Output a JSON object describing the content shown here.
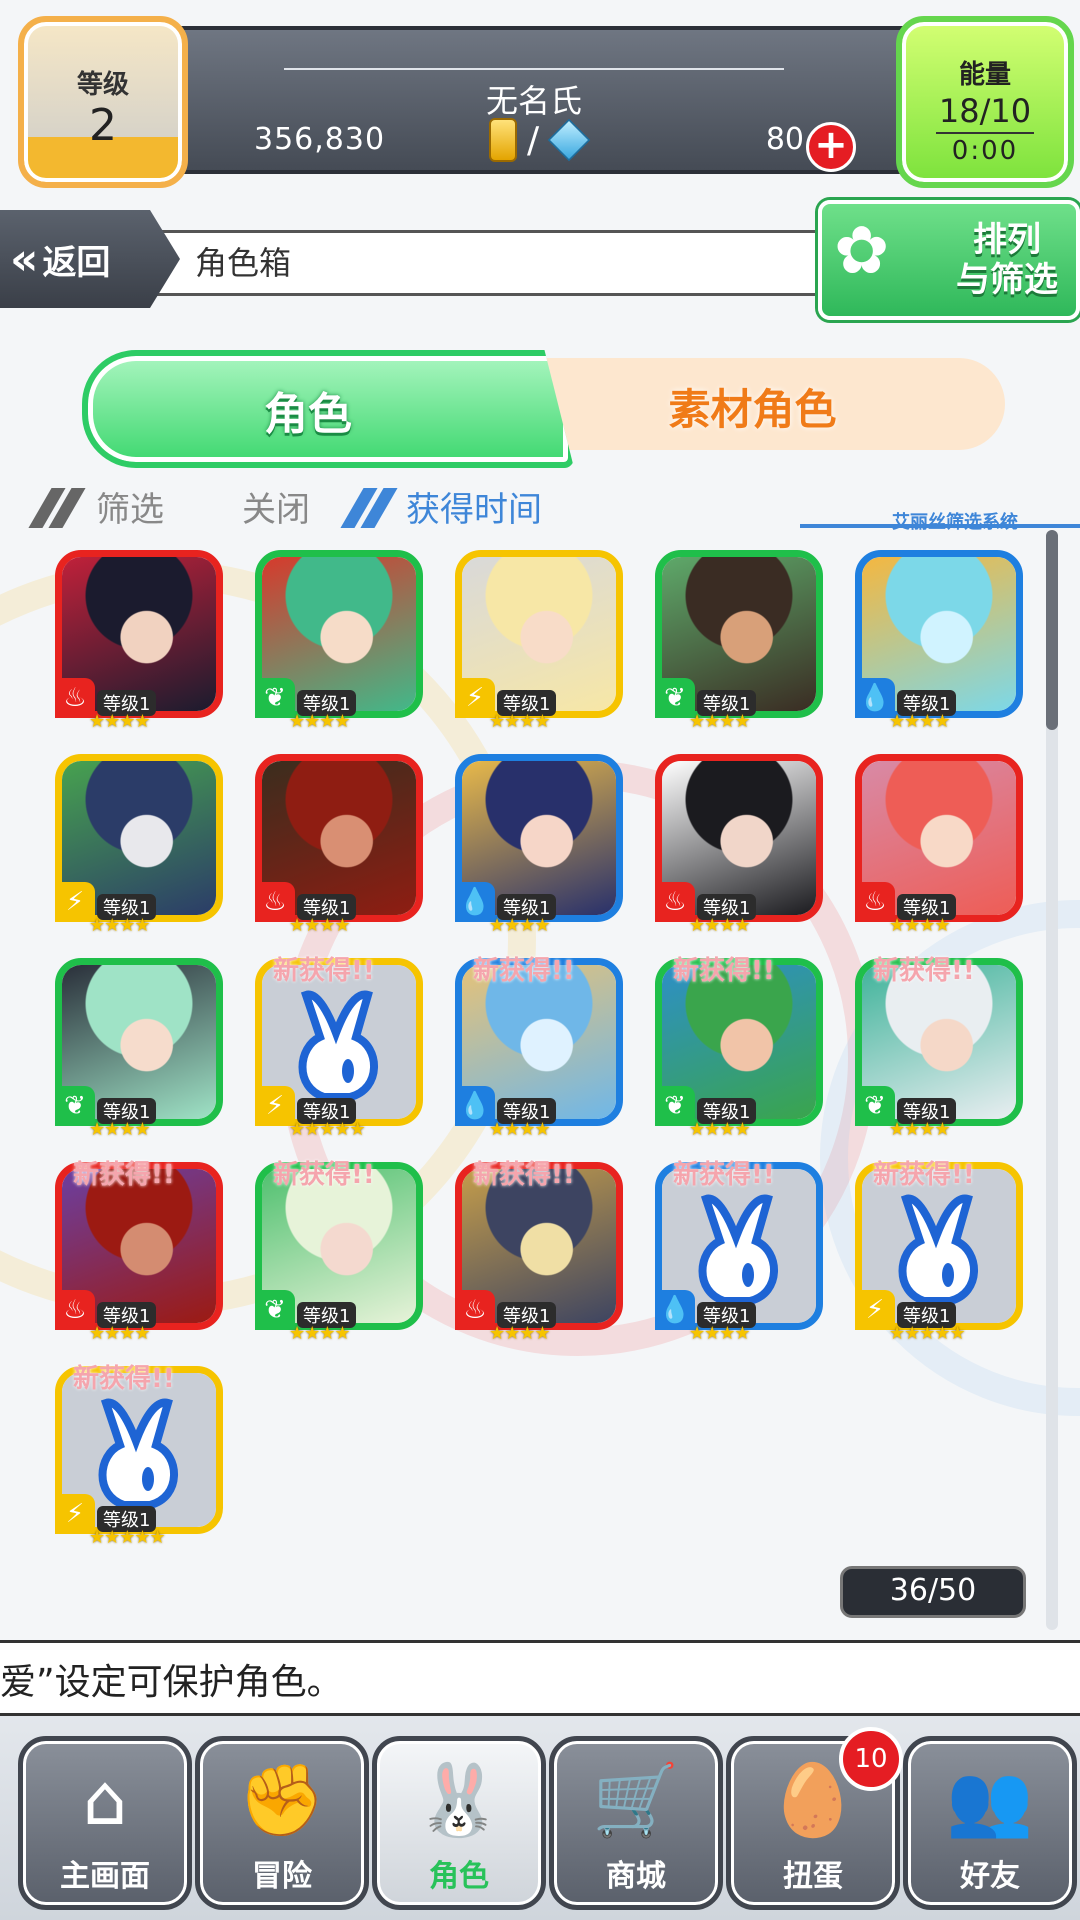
{
  "player": {
    "level_label": "等级",
    "level": "2",
    "name": "无名氏",
    "gold": "356,830",
    "currency_separator": "/",
    "gems": "80",
    "add_symbol": "+"
  },
  "energy": {
    "label": "能量",
    "value": "18/10",
    "timer": "0:00"
  },
  "header": {
    "back_label": "返回",
    "back_icon": "«",
    "title": "角色箱",
    "sort_label_line1": "排列",
    "sort_label_line2": "与筛选"
  },
  "tabs": {
    "characters": "角色",
    "materials": "素材角色"
  },
  "filter": {
    "filter_label": "筛选",
    "filter_state": "关闭",
    "sort_label": "获得时间",
    "system_label": "艾丽丝筛选系统"
  },
  "elements": {
    "fire": {
      "color": "#e8231f",
      "glyph": "♨"
    },
    "wood": {
      "color": "#1fbf4a",
      "glyph": "❦"
    },
    "thunder": {
      "color": "#f6c400",
      "glyph": "⚡"
    },
    "water": {
      "color": "#1e7fe0",
      "glyph": "💧"
    }
  },
  "cards": [
    {
      "element": "fire",
      "level": "等级1",
      "stars": "★★★★",
      "new": "",
      "rabbit": false,
      "art": [
        "#1b1b2e",
        "#f1d2c0",
        "#c0213a"
      ]
    },
    {
      "element": "wood",
      "level": "等级1",
      "stars": "★★★★",
      "new": "",
      "rabbit": false,
      "art": [
        "#41b98a",
        "#f6dcc8",
        "#d63a2c"
      ]
    },
    {
      "element": "thunder",
      "level": "等级1",
      "stars": "★★★★",
      "new": "",
      "rabbit": false,
      "art": [
        "#f7e7a6",
        "#f8dcc8",
        "#d9d9d9"
      ]
    },
    {
      "element": "wood",
      "level": "等级1",
      "stars": "★★★★",
      "new": "",
      "rabbit": false,
      "art": [
        "#3a2c23",
        "#d8a079",
        "#5ea96a"
      ]
    },
    {
      "element": "water",
      "level": "等级1",
      "stars": "★★★★",
      "new": "",
      "rabbit": false,
      "art": [
        "#7cd8e8",
        "#d0f3ff",
        "#f4b740"
      ]
    },
    {
      "element": "thunder",
      "level": "等级1",
      "stars": "★★★★",
      "new": "",
      "rabbit": false,
      "art": [
        "#2b3c68",
        "#e8e8ec",
        "#47a24f"
      ]
    },
    {
      "element": "fire",
      "level": "等级1",
      "stars": "★★★★",
      "new": "",
      "rabbit": false,
      "art": [
        "#8f1d12",
        "#d98f73",
        "#3b2d1e"
      ]
    },
    {
      "element": "water",
      "level": "等级1",
      "stars": "★★★★",
      "new": "",
      "rabbit": false,
      "art": [
        "#28306b",
        "#f6d6c8",
        "#e8b94a"
      ]
    },
    {
      "element": "fire",
      "level": "等级1",
      "stars": "★★★★",
      "new": "",
      "rabbit": false,
      "art": [
        "#1b1b1f",
        "#f1d6c9",
        "#ffffff"
      ]
    },
    {
      "element": "fire",
      "level": "等级1",
      "stars": "★★★★",
      "new": "",
      "rabbit": false,
      "art": [
        "#ee5d56",
        "#f8d9c7",
        "#d88aa6"
      ]
    },
    {
      "element": "wood",
      "level": "等级1",
      "stars": "★★★★",
      "new": "",
      "rabbit": false,
      "art": [
        "#9fe3c6",
        "#f6dccc",
        "#2a2f3a"
      ]
    },
    {
      "element": "thunder",
      "level": "等级1",
      "stars": "★★★★★",
      "new": "新获得!!",
      "rabbit": true,
      "art": []
    },
    {
      "element": "water",
      "level": "等级1",
      "stars": "★★★★",
      "new": "新获得!!",
      "rabbit": false,
      "art": [
        "#6fb7e8",
        "#dff2ff",
        "#e6c278"
      ]
    },
    {
      "element": "wood",
      "level": "等级1",
      "stars": "★★★★",
      "new": "新获得!!",
      "rabbit": false,
      "art": [
        "#3aa54c",
        "#f1c4a8",
        "#2d8fc7"
      ]
    },
    {
      "element": "wood",
      "level": "等级1",
      "stars": "★★★★",
      "new": "新获得!!",
      "rabbit": false,
      "art": [
        "#e9eef1",
        "#f5d8c8",
        "#3fb39a"
      ]
    },
    {
      "element": "fire",
      "level": "等级1",
      "stars": "★★★★",
      "new": "新获得!!",
      "rabbit": false,
      "art": [
        "#9c1a12",
        "#d48c71",
        "#6b3fa1"
      ]
    },
    {
      "element": "wood",
      "level": "等级1",
      "stars": "★★★★",
      "new": "新获得!!",
      "rabbit": false,
      "art": [
        "#e7f3d9",
        "#f4d9cf",
        "#4fc06f"
      ]
    },
    {
      "element": "fire",
      "level": "等级1",
      "stars": "★★★★",
      "new": "新获得!!",
      "rabbit": false,
      "art": [
        "#3d4461",
        "#f0dfa5",
        "#c59d4a"
      ]
    },
    {
      "element": "water",
      "level": "等级1",
      "stars": "★★★★",
      "new": "新获得!!",
      "rabbit": true,
      "art": []
    },
    {
      "element": "thunder",
      "level": "等级1",
      "stars": "★★★★★",
      "new": "新获得!!",
      "rabbit": true,
      "art": []
    },
    {
      "element": "thunder",
      "level": "等级1",
      "stars": "★★★★★",
      "new": "新获得!!",
      "rabbit": true,
      "art": []
    }
  ],
  "box_count": "36/50",
  "hint": "爱”设定可保护角色。",
  "nav": [
    {
      "id": "home",
      "label": "主画面",
      "icon": "⌂",
      "badge": "",
      "active": false
    },
    {
      "id": "adventure",
      "label": "冒险",
      "icon": "✊",
      "badge": "",
      "active": false
    },
    {
      "id": "characters",
      "label": "角色",
      "icon": "🐰",
      "badge": "",
      "active": true
    },
    {
      "id": "shop",
      "label": "商城",
      "icon": "🛒",
      "badge": "",
      "active": false
    },
    {
      "id": "gacha",
      "label": "扭蛋",
      "icon": "🥚",
      "badge": "10",
      "active": false
    },
    {
      "id": "friends",
      "label": "好友",
      "icon": "👥",
      "badge": "",
      "active": false
    }
  ]
}
